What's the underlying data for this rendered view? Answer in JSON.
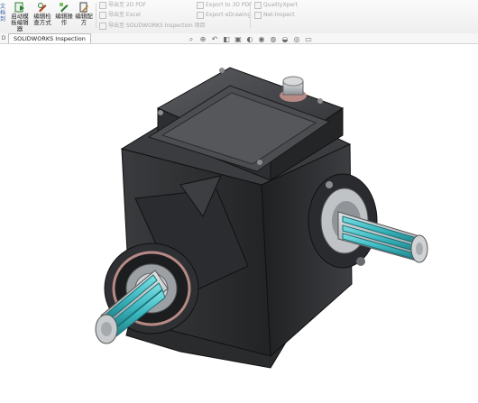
{
  "ribbon": {
    "left_edge": "文\n档\n到",
    "buttons": [
      {
        "label": "启动模\n板编辑\n器",
        "icon": "template-editor-icon",
        "color": "#2f7d32"
      },
      {
        "label": "编辑检\n查方式",
        "icon": "edit-method-icon",
        "color": "#b23a1c"
      },
      {
        "label": "编辑操\n作",
        "icon": "edit-operation-icon",
        "color": "#2f7d32"
      },
      {
        "label": "编辑配\n方",
        "icon": "edit-recipe-icon",
        "color": "#444444"
      }
    ],
    "export_col1": [
      "导出至 2D PDF",
      "导出至 Excel",
      "导出至 SOLIDWORKS Inspection 项目"
    ],
    "export_col2": [
      "Export to 3D PDF",
      "Export eDrawing"
    ],
    "export_col3": [
      "QualityXpert",
      "Net-Inspect"
    ]
  },
  "tabs": {
    "prev_label": "D",
    "active": "SOLIDWORKS Inspection"
  },
  "hud_icons": [
    "search-icon",
    "zoom-area-icon",
    "previous-view-icon",
    "section-view-icon",
    "view-orientation-icon",
    "display-style-icon",
    "hide-show-icon",
    "edit-appearance-icon",
    "scenes-icon",
    "view-settings-icon",
    "monitor-icon"
  ],
  "colors": {
    "body": "#2a2b2d",
    "body_light": "#46484b",
    "shaft_teal": "#44c2c9",
    "shaft_steel": "#b9bcc0",
    "seal_ring": "#b78a86"
  }
}
